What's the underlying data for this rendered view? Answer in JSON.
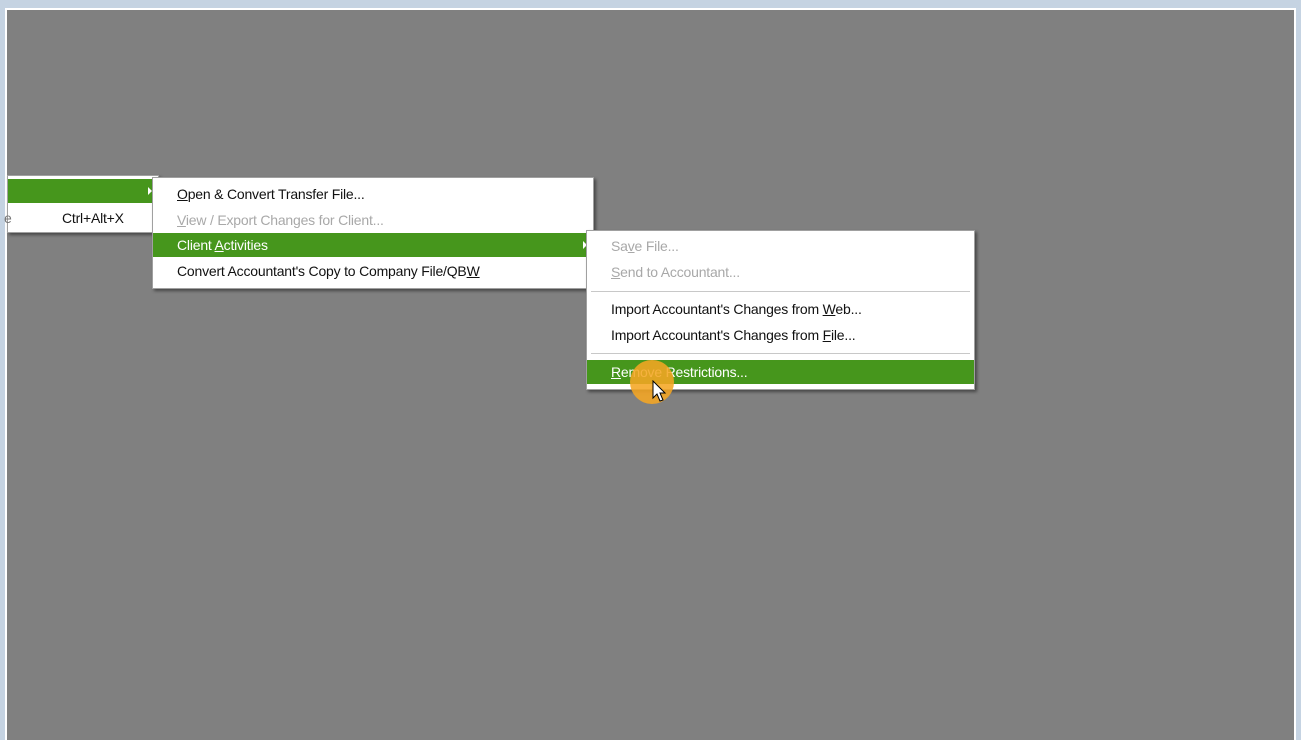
{
  "menu1": {
    "shortcut_text": "Ctrl+Alt+X",
    "partial_left_text": "e"
  },
  "menu2": {
    "items": [
      {
        "pre": "",
        "u": "O",
        "post": "pen & Convert Transfer File...",
        "state": "normal"
      },
      {
        "pre": "",
        "u": "V",
        "post": "iew / Export Changes for Client...",
        "state": "disabled"
      },
      {
        "pre": "Client ",
        "u": "A",
        "post": "ctivities",
        "state": "highlighted"
      },
      {
        "pre": "Convert Accountant's Copy to Company File/QB",
        "u": "W",
        "post": "",
        "state": "normal"
      }
    ]
  },
  "menu3": {
    "items": [
      {
        "pre": "Sa",
        "u": "v",
        "post": "e File...",
        "state": "disabled"
      },
      {
        "pre": "",
        "u": "S",
        "post": "end to Accountant...",
        "state": "disabled"
      },
      {
        "pre": "Import Accountant's Changes from ",
        "u": "W",
        "post": "eb...",
        "state": "normal"
      },
      {
        "pre": "Import Accountant's Changes from ",
        "u": "F",
        "post": "ile...",
        "state": "normal"
      },
      {
        "pre": "",
        "u": "R",
        "post": "emove Restrictions...",
        "state": "highlighted"
      }
    ]
  },
  "colors": {
    "highlight": "#46961c",
    "workspace": "#808080",
    "frame": "#c5d3e2",
    "cursor_indicator": "#f5a623"
  },
  "icons": {
    "submenu_arrow": "chevron-right-icon",
    "mouse_pointer": "cursor-arrow-icon"
  }
}
